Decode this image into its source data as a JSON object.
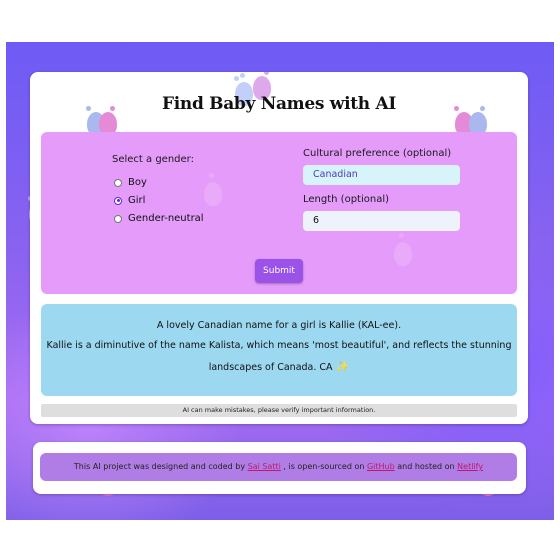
{
  "app": {
    "title": "Find Baby Names with AI"
  },
  "form": {
    "gender_label": "Select a gender:",
    "gender_options": [
      {
        "label": "Boy",
        "checked": false
      },
      {
        "label": "Girl",
        "checked": true
      },
      {
        "label": "Gender-neutral",
        "checked": false
      }
    ],
    "culture_label": "Cultural preference (optional)",
    "culture_value": "Canadian",
    "length_label": "Length (optional)",
    "length_value": "6",
    "submit_label": "Submit"
  },
  "result": {
    "line1": "A lovely Canadian name for a girl is Kallie (KAL-ee).",
    "line2": "Kallie is a diminutive of the name Kalista, which means 'most beautiful', and reflects the stunning",
    "line3": "landscapes of Canada. CA"
  },
  "disclaimer": "AI can make mistakes, please verify important information.",
  "footer": {
    "text_before": "This AI project was designed and coded by ",
    "author_link": "Sai Satti",
    "text_mid1": " , is open-sourced on ",
    "github_link": "GitHub",
    "text_mid2": " and hosted on ",
    "netlify_link": "Netlify"
  },
  "colors": {
    "form_panel": "#e49bfa",
    "result_panel": "#9dd8f1",
    "submit": "#9a52e8",
    "footer_bar": "#b07de6",
    "link": "#c2186b"
  },
  "icons": {
    "decor": "baby-footprint-icon",
    "sparkle": "sparkle-icon"
  }
}
